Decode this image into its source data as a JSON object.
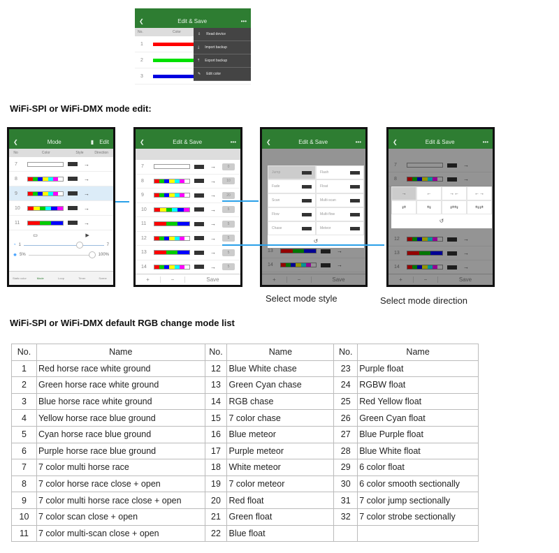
{
  "top_screen": {
    "title": "Edit & Save",
    "col_no": "No.",
    "col_color": "Color",
    "rows": [
      "1",
      "2",
      "3"
    ],
    "row_colors": [
      "#ff0000",
      "#00e000",
      "#0000e0"
    ],
    "menu": [
      {
        "icon": "download-device-icon",
        "label": "Read device"
      },
      {
        "icon": "import-icon",
        "label": "Import backup"
      },
      {
        "icon": "export-icon",
        "label": "Export backup"
      },
      {
        "icon": "edit-icon",
        "label": "Edit color"
      }
    ]
  },
  "section1": "WiFi-SPI or WiFi-DMX mode edit:",
  "phone_mode": {
    "title": "Mode",
    "edit": "Edit",
    "headers": [
      "No",
      "Color",
      "Style",
      "Direction"
    ],
    "rows": [
      "7",
      "8",
      "9",
      "10",
      "11"
    ],
    "speed_min": "1",
    "speed_max": "7",
    "bright_min": "5%",
    "bright_max": "100%",
    "speed_level": 0.7,
    "bright_level": 1.0,
    "tabs": [
      "Static color",
      "Mode",
      "Loop",
      "Timer",
      "Scene"
    ]
  },
  "phone_edit": {
    "title": "Edit & Save",
    "rows": [
      {
        "no": "7",
        "v": "0"
      },
      {
        "no": "8",
        "v": "10"
      },
      {
        "no": "9",
        "v": "20"
      },
      {
        "no": "10",
        "v": "5"
      },
      {
        "no": "11",
        "v": "5"
      },
      {
        "no": "12",
        "v": "5"
      },
      {
        "no": "13",
        "v": "5"
      },
      {
        "no": "14",
        "v": "5"
      }
    ],
    "add": "+",
    "remove": "−",
    "save": "Save"
  },
  "phone_style": {
    "title": "Edit & Save",
    "styles": [
      "Jump",
      "Flash",
      "Fade",
      "Float",
      "Scan",
      "Multi-scan",
      "Flow",
      "Multi-flow",
      "Chase",
      "Meteor"
    ],
    "back": "↺",
    "rows": [
      "13",
      "14"
    ]
  },
  "phone_dir": {
    "title": "Edit & Save",
    "dirs": [
      "→",
      "←",
      "→←",
      "←→",
      "⇄",
      "⇆",
      "⇄⇆",
      "⇆⇄"
    ],
    "back": "↺",
    "rows_top": [
      "7",
      "8"
    ],
    "rows_bottom": [
      "12",
      "13",
      "14"
    ]
  },
  "caption_style": "Select mode style",
  "caption_direction": "Select mode direction",
  "section2": "WiFi-SPI or WiFi-DMX default RGB change mode list",
  "table": {
    "headers": [
      "No.",
      "Name",
      "No.",
      "Name",
      "No.",
      "Name"
    ],
    "rows": [
      [
        "1",
        "Red horse race white ground",
        "12",
        "Blue White chase",
        "23",
        "Purple float"
      ],
      [
        "2",
        "Green horse race white ground",
        "13",
        "Green Cyan chase",
        "24",
        "RGBW float"
      ],
      [
        "3",
        "Blue horse race white ground",
        "14",
        "RGB chase",
        "25",
        "Red Yellow float"
      ],
      [
        "4",
        "Yellow horse race blue ground",
        "15",
        "7 color chase",
        "26",
        "Green Cyan float"
      ],
      [
        "5",
        "Cyan horse race blue ground",
        "16",
        "Blue meteor",
        "27",
        "Blue Purple float"
      ],
      [
        "6",
        "Purple horse race blue ground",
        "17",
        "Purple meteor",
        "28",
        "Blue White float"
      ],
      [
        "7",
        "7 color multi horse race",
        "18",
        "White meteor",
        "29",
        "6 color float"
      ],
      [
        "8",
        "7 color horse race close + open",
        "19",
        "7 color meteor",
        "30",
        "6 color smooth sectionally"
      ],
      [
        "9",
        "7 color multi horse race close + open",
        "20",
        "Red float",
        "31",
        "7 color jump sectionally"
      ],
      [
        "10",
        "7 color scan close + open",
        "21",
        "Green float",
        "32",
        "7 color strobe sectionally"
      ],
      [
        "11",
        "7 color multi-scan close + open",
        "22",
        "Blue float",
        "",
        ""
      ]
    ]
  },
  "colors": {
    "app_green": "#2e7d32",
    "arrow_blue": "#2aa0e8"
  },
  "strips": {
    "7": [
      "#ffffff"
    ],
    "8": [
      "#f00",
      "#0c0",
      "#00f",
      "#ff0",
      "#0ff",
      "#f0f",
      "#fff"
    ],
    "9": [
      "#f00",
      "#0c0",
      "#00f",
      "#ff0",
      "#0ff",
      "#f0f",
      "#fff"
    ],
    "10": [
      "#f00",
      "#ff0",
      "#0c0",
      "#0ff",
      "#00f",
      "#f0f"
    ],
    "11": [
      "#f00",
      "#0c0",
      "#00f"
    ],
    "12": [
      "#f00",
      "#0c0",
      "#00f",
      "#ff0",
      "#0ff",
      "#f0f",
      "#fff"
    ],
    "13": [
      "#f00",
      "#0c0",
      "#00f"
    ],
    "14": [
      "#f00",
      "#0c0",
      "#00f",
      "#ff0",
      "#0ff",
      "#f0f",
      "#fff"
    ]
  }
}
